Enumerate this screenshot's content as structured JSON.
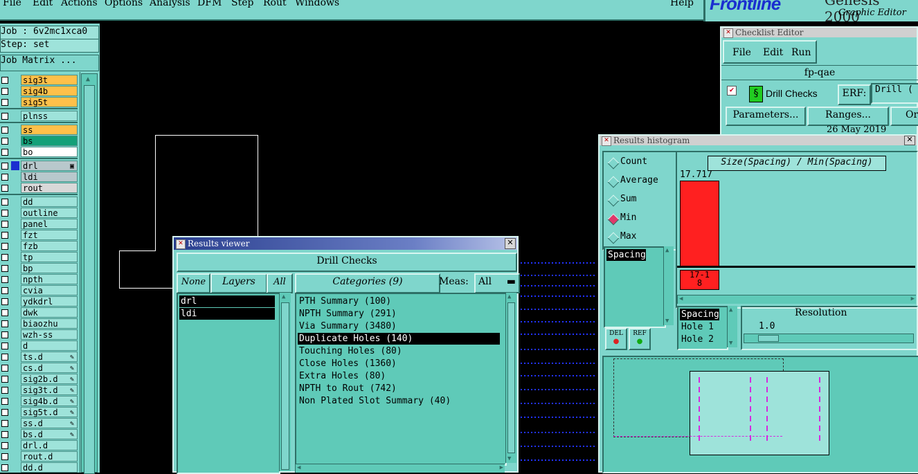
{
  "menubar": {
    "items": [
      "File",
      "Edit",
      "Actions",
      "Options",
      "Analysis",
      "DFM",
      "Step",
      "Rout",
      "Windows"
    ],
    "help": "Help"
  },
  "brand": {
    "logo": "Frontline",
    "product": "Genesis 2000",
    "subtitle": "Graphic Editor"
  },
  "job": {
    "job_line": "Job : 6v2mc1xca0",
    "step_line": "Step: set",
    "matrix_button": "Job Matrix ..."
  },
  "layers": {
    "group1": [
      {
        "name": "sig3t",
        "color": "#ffc04a"
      },
      {
        "name": "sig4b",
        "color": "#ffc04a"
      },
      {
        "name": "sig5t",
        "color": "#ffc04a"
      }
    ],
    "group2": [
      {
        "name": "plnss",
        "color": "#9ee3da"
      }
    ],
    "group3": [
      {
        "name": "ss",
        "color": "#ffc04a"
      },
      {
        "name": "bs",
        "color": "#14a078"
      },
      {
        "name": "bo",
        "color": "#ffffff"
      }
    ],
    "group4": [
      {
        "name": "drl",
        "color": "#b8c8cc",
        "active": true
      },
      {
        "name": "ldi",
        "color": "#b8c8cc"
      },
      {
        "name": "rout",
        "color": "#d8d8d8"
      }
    ],
    "group5": [
      "dd",
      "outline",
      "panel",
      "fzt",
      "fzb",
      "tp",
      "bp",
      "npth",
      "cvia",
      "ydkdrl",
      "dwk",
      "biaozhu",
      "wzh-ss",
      "d",
      "ts.d",
      "cs.d",
      "sig2b.d",
      "sig3t.d",
      "sig4b.d",
      "sig5t.d",
      "ss.d",
      "bs.d",
      "drl.d",
      "rout.d",
      "dd.d"
    ],
    "group5_marked": [
      "ts.d",
      "cs.d",
      "sig2b.d",
      "sig3t.d",
      "sig4b.d",
      "sig5t.d",
      "ss.d",
      "bs.d"
    ]
  },
  "results_viewer": {
    "title": "Results viewer",
    "heading": "Drill Checks",
    "none_btn": "None",
    "layers_btn": "Layers",
    "all_btn": "All",
    "categories_btn": "Categories (9)",
    "meas_label": "Meas:",
    "meas_value": "All",
    "layer_items": [
      "drl",
      "ldi"
    ],
    "category_items": [
      "PTH Summary (100)",
      "NPTH Summary (291)",
      "Via Summary (3480)",
      "Duplicate Holes (140)",
      "Touching Holes (80)",
      "Close Holes (1360)",
      "Extra Holes (80)",
      "NPTH to Rout (742)",
      "Non Plated Slot Summary (40)"
    ],
    "selected_category": "Duplicate Holes (140)"
  },
  "checklist_editor": {
    "title": "Checklist Editor",
    "menu": [
      "File",
      "Edit",
      "Run"
    ],
    "checklist_name": "fp-qae",
    "check_name": "Drill Checks",
    "erf_label": "ERF:",
    "erf_value": "Drill (",
    "buttons": [
      "Parameters...",
      "Ranges...",
      "Or"
    ],
    "date": "26 May 2019"
  },
  "histogram": {
    "title": "Results histogram",
    "modes": [
      "Count",
      "Average",
      "Sum",
      "Min",
      "Max"
    ],
    "selected_mode": "Min",
    "measure_list": [
      "Spacing"
    ],
    "chart_title": "Size(Spacing) / Min(Spacing)",
    "bar_value_label": "17.717",
    "bar_range_label": "17-18",
    "bar_color": "#ff2020",
    "del_btn": "DEL",
    "ref_btn": "REF",
    "param_list": [
      "Spacing",
      "Hole 1",
      "Hole 2"
    ],
    "resolution_label": "Resolution",
    "resolution_value": "1.0"
  }
}
